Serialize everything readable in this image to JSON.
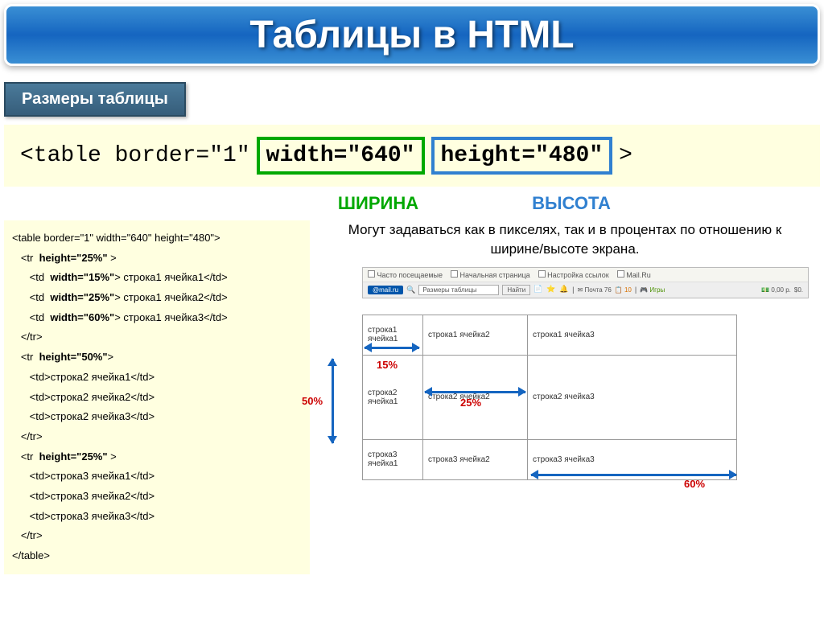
{
  "title": "Таблицы в HTML",
  "subtitle": "Размеры таблицы",
  "codeLine": {
    "prefix": "<table border=\"1\"",
    "widthAttr": "width=\"640\"",
    "heightAttr": "height=\"480\"",
    "suffix": ">"
  },
  "labels": {
    "width": "ШИРИНА",
    "height": "ВЫСОТА"
  },
  "description": "Могут задаваться как в пикселях, так и в процентах по отношению к ширине/высоте экрана.",
  "codeBlock": [
    "<table border=\"1\" width=\"640\" height=\"480\">",
    "   <tr  height=\"25%\" >",
    "      <td  width=\"15%\"> строка1 ячейка1</td>",
    "      <td  width=\"25%\"> строка1 ячейка2</td>",
    "      <td  width=\"60%\"> строка1 ячейка3</td>",
    "   </tr>",
    "   <tr  height=\"50%\">",
    "      <td>строка2 ячейка1</td>",
    "      <td>строка2 ячейка2</td>",
    "      <td>строка2 ячейка3</td>",
    "   </tr>",
    "   <tr  height=\"25%\" >",
    "      <td>строка3 ячейка1</td>",
    "      <td>строка3 ячейка2</td>",
    "      <td>строка3 ячейка3</td>",
    "   </tr>",
    "</table>"
  ],
  "browser": {
    "toolbar1": {
      "frequent": "Часто посещаемые",
      "home": "Начальная страница",
      "links": "Настройка ссылок",
      "mailru": "Mail.Ru"
    },
    "toolbar2": {
      "badge": "@mail.ru",
      "searchText": "Размеры таблицы",
      "find": "Найти",
      "mail": "Почта 76",
      "count": "10",
      "games": "Игры",
      "price": "0,00 р.",
      "money": "$0."
    }
  },
  "percents": {
    "p15": "15%",
    "p25": "25%",
    "p50": "50%",
    "p60": "60%"
  },
  "cells": {
    "r1c1": "строка1 ячейка1",
    "r1c2": "строка1 ячейка2",
    "r1c3": "строка1 ячейка3",
    "r2c1": "строка2 ячейка1",
    "r2c2": "строка2 ячейка2",
    "r2c3": "строка2 ячейка3",
    "r3c1": "строка3 ячейка1",
    "r3c2": "строка3 ячейка2",
    "r3c3": "строка3 ячейка3"
  }
}
